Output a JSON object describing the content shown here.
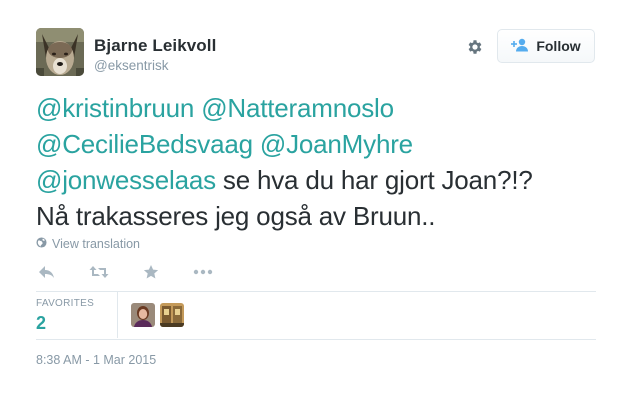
{
  "author": {
    "name": "Bjarne Leikvoll",
    "handle": "@eksentrisk"
  },
  "header": {
    "follow_label": "Follow",
    "settings_icon": "gear-icon",
    "follow_icon": "add-user-icon"
  },
  "tweet": {
    "mentions": [
      "@kristinbruun",
      "@Natteramnoslo",
      "@CecilieBedsvaag",
      "@JoanMyhre",
      "@jonwesselaas"
    ],
    "text_line_3": " se hva du har gjort Joan?!?",
    "text_line_4": "Nå trakasseres jeg også av Bruun.."
  },
  "translation": {
    "label": "View translation",
    "icon": "globe-icon"
  },
  "actions": {
    "reply_icon": "reply-icon",
    "retweet_icon": "retweet-icon",
    "favorite_icon": "star-icon",
    "more_icon": "more-icon"
  },
  "stats": {
    "favorites_label": "FAVORITES",
    "favorites_count": "2"
  },
  "timestamp": "8:38 AM - 1 Mar 2015",
  "colors": {
    "link": "#2aa3a0",
    "muted": "#8899a6",
    "text": "#292f33",
    "divider": "#e1e8ed"
  }
}
